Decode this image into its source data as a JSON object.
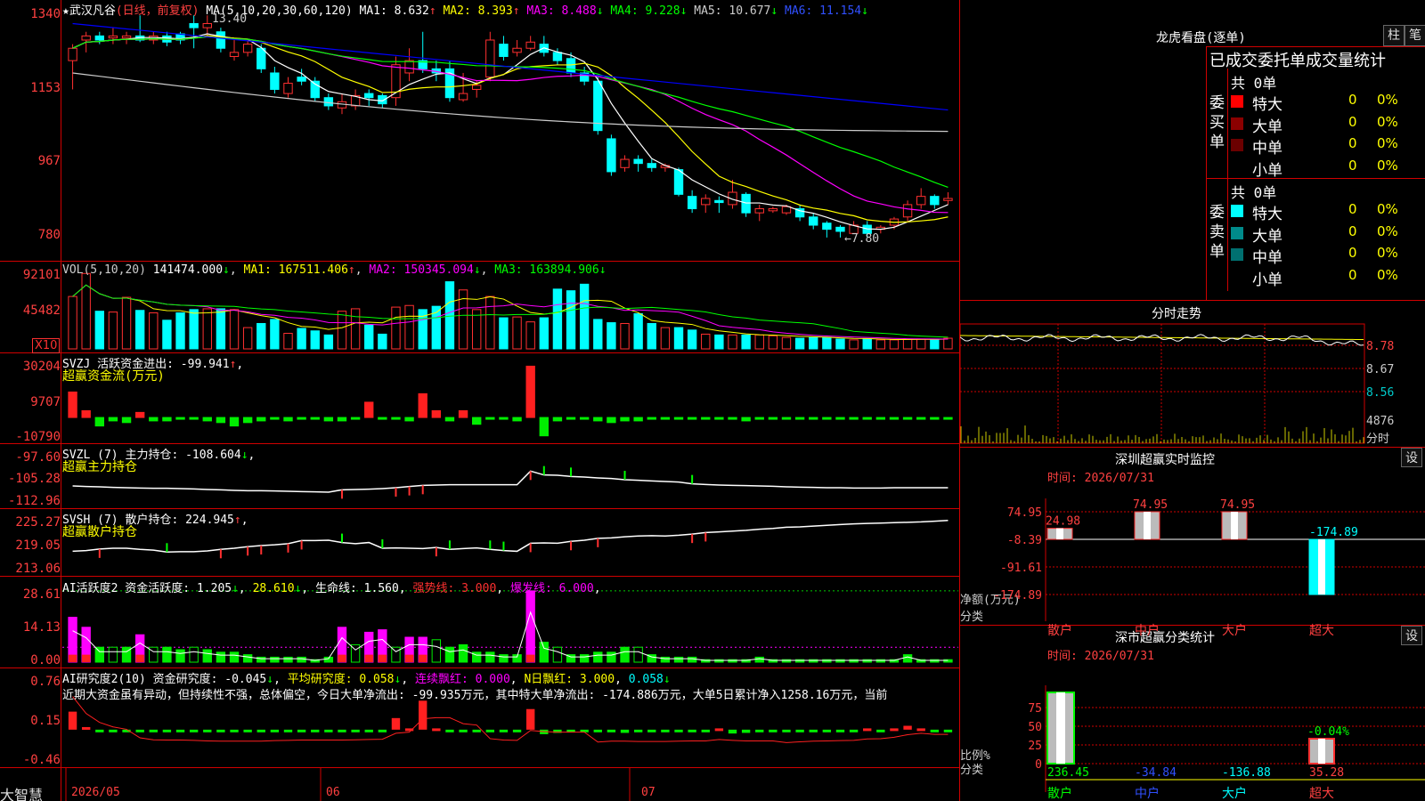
{
  "stock": {
    "name": "武汉凡谷",
    "mode": "(日线，前复权)",
    "high_mark": "13.40",
    "low_mark": "←7.80"
  },
  "main_axis": [
    "1340",
    "1153",
    "967",
    "780"
  ],
  "ma_labels": {
    "ma": "MA(5,10,20,30,60,120)",
    "ma1": "MA1: 8.632",
    "ma2": "MA2: 8.393",
    "ma3": "MA3: 8.488",
    "ma4": "MA4: 9.228",
    "ma5": "MA5: 10.677",
    "ma6": "MA6: 11.154"
  },
  "vol": {
    "title": "VOL(5,10,20)",
    "value": "141474.000",
    "ma1": "MA1: 167511.406",
    "ma2": "MA2: 150345.094",
    "ma3": "MA3: 163894.906",
    "axis": [
      "92101",
      "45482"
    ],
    "unit": "X10"
  },
  "svzj": {
    "title": "SVZJ  活跃资金进出: -99.941",
    "sub": "超赢资金流(万元)",
    "axis": [
      "30204",
      "9707",
      "-10790"
    ]
  },
  "svzl": {
    "title": "SVZL (7) 主力持仓: -108.604",
    "sub": "超赢主力持仓",
    "axis": [
      "-97.60",
      "-105.28",
      "-112.96"
    ]
  },
  "svsh": {
    "title": "SVSH (7) 散户持仓: 224.945",
    "sub": "超赢散户持仓",
    "axis": [
      "225.27",
      "219.05",
      "213.06"
    ]
  },
  "ai1": {
    "title": "AI活跃度2 资金活跃度: 1.205",
    "v2": "28.610",
    "life": "生命线: 1.560",
    "strong": "强势线: 3.000",
    "burst": "爆发线: 6.000",
    "axis": [
      "28.61",
      "14.13",
      "0.00"
    ]
  },
  "ai2": {
    "title": "AI研究度2(10) 资金研究度: -0.045",
    "avg": "平均研究度: 0.058",
    "cont": "连续飘红: 0.000",
    "nday": "N日飘红: 3.000",
    "last": "0.058",
    "axis": [
      "0.76",
      "0.15",
      "-0.46"
    ],
    "comment": "近期大资金虽有异动，但持续性不强，总体偏空，今日大单净流出: -99.935万元，其中特大单净流出: -174.886万元，大单5日累计净入1258.16万元，当前"
  },
  "dates": [
    "2026/05",
    "06",
    "07"
  ],
  "brand": "大智慧",
  "right": {
    "lhb": {
      "title": "龙虎看盘(逐单)",
      "btn1": "柱",
      "btn2": "笔",
      "header": "已成交委托单成交量统计",
      "buy": {
        "label": "委买单",
        "total": "共 0单",
        "rows": [
          {
            "name": "特大",
            "val": "0",
            "pct": "0%",
            "color": "#ff0000"
          },
          {
            "name": "大单",
            "val": "0",
            "pct": "0%",
            "color": "#8b0000"
          },
          {
            "name": "中单",
            "val": "0",
            "pct": "0%",
            "color": "#6b0000"
          },
          {
            "name": "小单",
            "val": "0",
            "pct": "0%",
            "color": "#000"
          }
        ]
      },
      "sell": {
        "label": "委卖单",
        "total": "共 0单",
        "rows": [
          {
            "name": "特大",
            "val": "0",
            "pct": "0%",
            "color": "#00ffff"
          },
          {
            "name": "大单",
            "val": "0",
            "pct": "0%",
            "color": "#008b8b"
          },
          {
            "name": "中单",
            "val": "0",
            "pct": "0%",
            "color": "#007070"
          },
          {
            "name": "小单",
            "val": "0",
            "pct": "0%",
            "color": "#000"
          }
        ]
      }
    },
    "fenshi": {
      "title": "分时走势",
      "axis": [
        "8.78",
        "8.67",
        "8.56"
      ],
      "vol": "4876",
      "unit": "分时"
    },
    "sz": {
      "title": "深圳超赢实时监控",
      "btn": "设",
      "time": "时间: 2026/07/31",
      "axis": [
        "74.95",
        "-8.39",
        "-91.61",
        "-174.89"
      ],
      "ylabel": "净额(万元)",
      "xlabel": "分类",
      "cats": [
        "散户",
        "中户",
        "大户",
        "超大"
      ],
      "vals": [
        "24.98",
        "74.95",
        "74.95",
        "-174.89"
      ]
    },
    "ss": {
      "title": "深市超赢分类统计",
      "btn": "设",
      "time": "时间: 2026/07/31",
      "axis": [
        "75",
        "50",
        "25",
        "0"
      ],
      "ylabel": "比例%",
      "xlabel": "分类",
      "cats": [
        "散户",
        "中户",
        "大户",
        "超大"
      ],
      "vals": [
        "236.45",
        "-34.84",
        "-136.88",
        "35.28"
      ],
      "pct": "-0.04%"
    }
  },
  "chart_data": [
    {
      "type": "candlestick",
      "title": "武汉凡谷",
      "ylim": [
        750,
        1360
      ],
      "candles": [
        [
          1230,
          1260,
          1160,
          1270
        ],
        [
          1280,
          1290,
          1250,
          1300
        ],
        [
          1290,
          1280,
          1270,
          1300
        ],
        [
          1285,
          1290,
          1270,
          1310
        ],
        [
          1285,
          1290,
          1270,
          1300
        ],
        [
          1290,
          1280,
          1275,
          1340
        ],
        [
          1280,
          1290,
          1270,
          1300
        ],
        [
          1290,
          1275,
          1265,
          1300
        ],
        [
          1295,
          1280,
          1270,
          1300
        ],
        [
          1320,
          1310,
          1260,
          1340
        ],
        [
          1310,
          1320,
          1290,
          1340
        ],
        [
          1300,
          1260,
          1250,
          1310
        ],
        [
          1240,
          1250,
          1230,
          1280
        ],
        [
          1250,
          1270,
          1240,
          1280
        ],
        [
          1260,
          1210,
          1200,
          1270
        ],
        [
          1200,
          1160,
          1150,
          1215
        ],
        [
          1150,
          1175,
          1140,
          1190
        ],
        [
          1190,
          1180,
          1170,
          1210
        ],
        [
          1180,
          1140,
          1130,
          1190
        ],
        [
          1140,
          1120,
          1110,
          1150
        ],
        [
          1115,
          1130,
          1100,
          1150
        ],
        [
          1120,
          1145,
          1110,
          1160
        ],
        [
          1150,
          1140,
          1120,
          1160
        ],
        [
          1145,
          1125,
          1115,
          1150
        ],
        [
          1140,
          1220,
          1120,
          1240
        ],
        [
          1200,
          1230,
          1180,
          1260
        ],
        [
          1230,
          1210,
          1200,
          1300
        ],
        [
          1210,
          1200,
          1180,
          1230
        ],
        [
          1210,
          1140,
          1130,
          1230
        ],
        [
          1135,
          1150,
          1130,
          1200
        ],
        [
          1160,
          1170,
          1140,
          1180
        ],
        [
          1190,
          1280,
          1180,
          1300
        ],
        [
          1270,
          1240,
          1230,
          1290
        ],
        [
          1250,
          1260,
          1240,
          1280
        ],
        [
          1260,
          1275,
          1255,
          1290
        ],
        [
          1270,
          1250,
          1240,
          1290
        ],
        [
          1250,
          1230,
          1220,
          1260
        ],
        [
          1235,
          1200,
          1190,
          1250
        ],
        [
          1200,
          1180,
          1170,
          1215
        ],
        [
          1180,
          1060,
          1050,
          1190
        ],
        [
          1040,
          960,
          950,
          1050
        ],
        [
          970,
          990,
          960,
          1000
        ],
        [
          990,
          980,
          960,
          1000
        ],
        [
          980,
          970,
          960,
          990
        ],
        [
          970,
          975,
          960,
          980
        ],
        [
          965,
          905,
          900,
          970
        ],
        [
          900,
          870,
          860,
          915
        ],
        [
          880,
          895,
          860,
          905
        ],
        [
          890,
          885,
          860,
          900
        ],
        [
          880,
          910,
          870,
          940
        ],
        [
          905,
          860,
          850,
          910
        ],
        [
          860,
          870,
          840,
          880
        ],
        [
          865,
          870,
          860,
          875
        ],
        [
          860,
          875,
          855,
          880
        ],
        [
          870,
          850,
          840,
          880
        ],
        [
          850,
          830,
          820,
          860
        ],
        [
          835,
          820,
          800,
          840
        ],
        [
          825,
          815,
          800,
          830
        ],
        [
          810,
          830,
          810,
          840
        ],
        [
          830,
          810,
          800,
          840
        ],
        [
          820,
          825,
          810,
          830
        ],
        [
          830,
          845,
          820,
          850
        ],
        [
          850,
          880,
          840,
          890
        ],
        [
          880,
          900,
          870,
          920
        ],
        [
          900,
          880,
          870,
          905
        ],
        [
          890,
          895,
          880,
          910
        ]
      ],
      "ma_series": [
        {
          "name": "MA1",
          "color": "#ffffff"
        },
        {
          "name": "MA2",
          "color": "#ffff00"
        },
        {
          "name": "MA3",
          "color": "#ff00ff"
        },
        {
          "name": "MA4",
          "color": "#00ff00"
        },
        {
          "name": "MA5",
          "color": "#cccccc"
        },
        {
          "name": "MA6",
          "color": "#0000ff"
        }
      ]
    },
    {
      "type": "bar",
      "title": "VOL",
      "ylim": [
        0,
        100000
      ],
      "values": [
        64000,
        92101,
        46000,
        45000,
        63000,
        47000,
        44000,
        35000,
        44000,
        48000,
        49000,
        49000,
        48000,
        26000,
        31000,
        36000,
        19000,
        25000,
        22000,
        17000,
        46000,
        49000,
        29000,
        18000,
        51000,
        53000,
        48000,
        52000,
        82000,
        72000,
        48000,
        64000,
        38000,
        39000,
        33000,
        38000,
        73000,
        71000,
        79000,
        36000,
        32000,
        31000,
        43000,
        31000,
        26000,
        26000,
        23000,
        18000,
        17000,
        17000,
        17000,
        17000,
        16000,
        14000,
        13000,
        14000,
        14000,
        12000,
        11000,
        12000,
        11000,
        11000,
        12000,
        12000,
        12000,
        13000
      ]
    },
    {
      "type": "bar",
      "title": "SVZJ",
      "ylim": [
        -12000,
        32000
      ],
      "values": [
        15000,
        4000,
        -5000,
        -2000,
        -3000,
        3000,
        -2000,
        -2000,
        -1000,
        -1000,
        -2000,
        -3000,
        -5000,
        -3000,
        -2000,
        -1000,
        -2000,
        -1000,
        -1000,
        -2000,
        -2000,
        -1000,
        9000,
        -1000,
        -1000,
        -2000,
        14000,
        4000,
        -2000,
        4000,
        -4000,
        -1000,
        -1000,
        -2000,
        30204,
        -10790,
        -2000,
        -1000,
        -1000,
        -2000,
        -3000,
        -2000,
        -2000,
        -1000,
        -1000,
        -1000,
        -1000,
        -1000,
        -1000,
        -1000,
        -2000,
        -1000,
        -1000,
        -1000,
        -1000,
        -1000,
        -1000,
        -1000,
        -1000,
        -1000,
        -1000,
        -1000,
        -1000,
        -1000,
        -1000,
        -1000
      ]
    },
    {
      "type": "line",
      "title": "SVZL",
      "ylim": [
        -114,
        -96
      ],
      "values": [
        -108,
        -108.2,
        -108.3,
        -108.5,
        -108.6,
        -108.7,
        -108.8,
        -108.8,
        -108.9,
        -109,
        -109.2,
        -109.3,
        -109.5,
        -109.6,
        -109.6,
        -109.7,
        -109.8,
        -109.9,
        -110,
        -110.1,
        -109.3,
        -109.2,
        -109.1,
        -108.9,
        -108.6,
        -108.2,
        -107.8,
        -107.7,
        -107.6,
        -107.6,
        -107.6,
        -107.6,
        -107.6,
        -107.6,
        -103,
        -104.3,
        -104.4,
        -104.8,
        -105,
        -105.3,
        -105.5,
        -105.9,
        -106.1,
        -106.3,
        -106.5,
        -106.7,
        -107.3,
        -107.5,
        -107.7,
        -107.8,
        -107.9,
        -108,
        -108.1,
        -108.3,
        -108.4,
        -108.5,
        -108.6,
        -108.6,
        -108.7,
        -108.7,
        -108.7,
        -108.6,
        -108.6,
        -108.6,
        -108.6,
        -108.6
      ]
    },
    {
      "type": "line",
      "title": "SVSH",
      "ylim": [
        212,
        226
      ],
      "values": [
        216.8,
        217,
        217.4,
        217.6,
        217.6,
        217.3,
        217.1,
        216.6,
        216.7,
        216.7,
        216.9,
        217.3,
        217.6,
        218,
        218.3,
        218.5,
        218.8,
        219.6,
        219.6,
        219.7,
        219.1,
        218.8,
        219.1,
        217.6,
        217.7,
        217.6,
        217.5,
        217.8,
        217.3,
        217.5,
        217.7,
        217.3,
        217,
        216.8,
        218.9,
        219,
        218.9,
        219.4,
        219.7,
        220.2,
        220.3,
        220.6,
        220.8,
        220.9,
        220.8,
        221,
        221.3,
        221.7,
        221.9,
        222.1,
        222.3,
        222.6,
        222.8,
        223.1,
        223.2,
        223.4,
        223.6,
        223.8,
        224,
        224.1,
        224.2,
        224.3,
        224.4,
        224.5,
        224.7,
        224.9
      ]
    },
    {
      "type": "bar",
      "title": "AI活跃度2",
      "ylim": [
        0,
        30
      ],
      "values": [
        18,
        14,
        6,
        6,
        6,
        11,
        6,
        6,
        5,
        6,
        5,
        4,
        4,
        3,
        2,
        2,
        2,
        2,
        1,
        2,
        14,
        7,
        12,
        13,
        6,
        10,
        10,
        9,
        6,
        7,
        4,
        4,
        3,
        3,
        28.61,
        8,
        6,
        3,
        3,
        4,
        4,
        6,
        6,
        3,
        2,
        2,
        2,
        1,
        1,
        1,
        1,
        2,
        1,
        1,
        1,
        1,
        1,
        1,
        1,
        1,
        1,
        1,
        3,
        1,
        1,
        1
      ]
    },
    {
      "type": "bar",
      "title": "AI研究度2",
      "ylim": [
        -0.5,
        0.8
      ],
      "values": [
        0.28,
        0.04,
        -0.03,
        -0.03,
        -0.02,
        -0.02,
        -0.03,
        -0.04,
        -0.03,
        -0.03,
        -0.04,
        -0.04,
        -0.04,
        -0.03,
        -0.03,
        -0.02,
        -0.03,
        -0.03,
        -0.03,
        -0.03,
        -0.02,
        -0.02,
        -0.02,
        -0.02,
        0.18,
        0.02,
        0.45,
        0.02,
        -0.02,
        -0.03,
        -0.03,
        -0.03,
        -0.03,
        -0.03,
        0.32,
        -0.07,
        -0.05,
        -0.03,
        -0.03,
        -0.03,
        -0.04,
        -0.05,
        -0.04,
        -0.03,
        -0.03,
        -0.03,
        -0.04,
        -0.04,
        0.02,
        -0.06,
        -0.05,
        -0.04,
        -0.04,
        -0.04,
        -0.03,
        -0.03,
        -0.03,
        -0.03,
        -0.03,
        0.02,
        -0.02,
        0.02,
        0.06,
        0.02,
        -0.02,
        -0.02
      ]
    }
  ]
}
